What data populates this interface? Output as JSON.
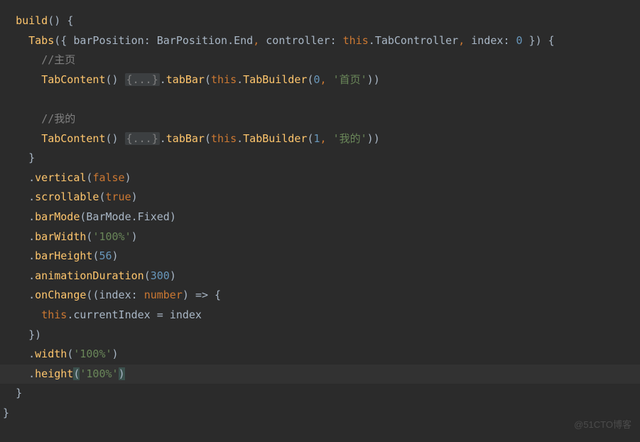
{
  "lines": {
    "l1": {
      "build": "build",
      "paren_o": "(",
      "paren_c": ")",
      "brace_o": "{"
    },
    "l2": {
      "Tabs": "Tabs",
      "paren_o": "(",
      "brace_o": "{",
      "barPosition": "barPosition",
      "colon1": ":",
      "BarPosition": "BarPosition",
      "dot1": ".",
      "End": "End",
      "comma1": ",",
      "controller": "controller",
      "colon2": ":",
      "this": "this",
      "dot2": ".",
      "TabController": "TabController",
      "comma2": ",",
      "index": "index",
      "colon3": ":",
      "zero": "0",
      "brace_c": "}",
      "paren_c": ")",
      "brace_o2": "{"
    },
    "l3": {
      "comment": "//主页"
    },
    "l4": {
      "TabContent": "TabContent",
      "p_o": "(",
      "p_c": ")",
      "fold": "{...}",
      "dot": ".",
      "tabBar": "tabBar",
      "p2_o": "(",
      "this": "this",
      "dot2": ".",
      "TabBuilder": "TabBuilder",
      "p3_o": "(",
      "zero": "0",
      "comma": ",",
      "str": "'首页'",
      "p3_c": ")",
      "p2_c": ")"
    },
    "l6": {
      "comment": "//我的"
    },
    "l7": {
      "TabContent": "TabContent",
      "p_o": "(",
      "p_c": ")",
      "fold": "{...}",
      "dot": ".",
      "tabBar": "tabBar",
      "p2_o": "(",
      "this": "this",
      "dot2": ".",
      "TabBuilder": "TabBuilder",
      "p3_o": "(",
      "one": "1",
      "comma": ",",
      "str": "'我的'",
      "p3_c": ")",
      "p2_c": ")"
    },
    "l8": {
      "brace_c": "}"
    },
    "l9": {
      "dot": ".",
      "vertical": "vertical",
      "p_o": "(",
      "false": "false",
      "p_c": ")"
    },
    "l10": {
      "dot": ".",
      "scrollable": "scrollable",
      "p_o": "(",
      "true": "true",
      "p_c": ")"
    },
    "l11": {
      "dot": ".",
      "barMode": "barMode",
      "p_o": "(",
      "BarMode": "BarMode",
      "dot2": ".",
      "Fixed": "Fixed",
      "p_c": ")"
    },
    "l12": {
      "dot": ".",
      "barWidth": "barWidth",
      "p_o": "(",
      "str": "'100%'",
      "p_c": ")"
    },
    "l13": {
      "dot": ".",
      "barHeight": "barHeight",
      "p_o": "(",
      "num": "56",
      "p_c": ")"
    },
    "l14": {
      "dot": ".",
      "animationDuration": "animationDuration",
      "p_o": "(",
      "num": "300",
      "p_c": ")"
    },
    "l15": {
      "dot": ".",
      "onChange": "onChange",
      "p_o": "(",
      "p2_o": "(",
      "index": "index",
      "colon": ":",
      "numbertype": "number",
      "p2_c": ")",
      "arrow": "=>",
      "brace_o": "{"
    },
    "l16": {
      "this": "this",
      "dot": ".",
      "currentIndex": "currentIndex",
      "eq": "=",
      "index": "index"
    },
    "l17": {
      "brace_c": "}",
      "p_c": ")"
    },
    "l18": {
      "dot": ".",
      "width": "width",
      "p_o": "(",
      "str": "'100%'",
      "p_c": ")"
    },
    "l19": {
      "dot": ".",
      "height": "height",
      "p_o": "(",
      "str": "'100%'",
      "p_c": ")"
    },
    "l20": {
      "brace_c": "}"
    },
    "l21": {
      "brace_c": "}"
    }
  },
  "watermark": "@51CTO博客"
}
